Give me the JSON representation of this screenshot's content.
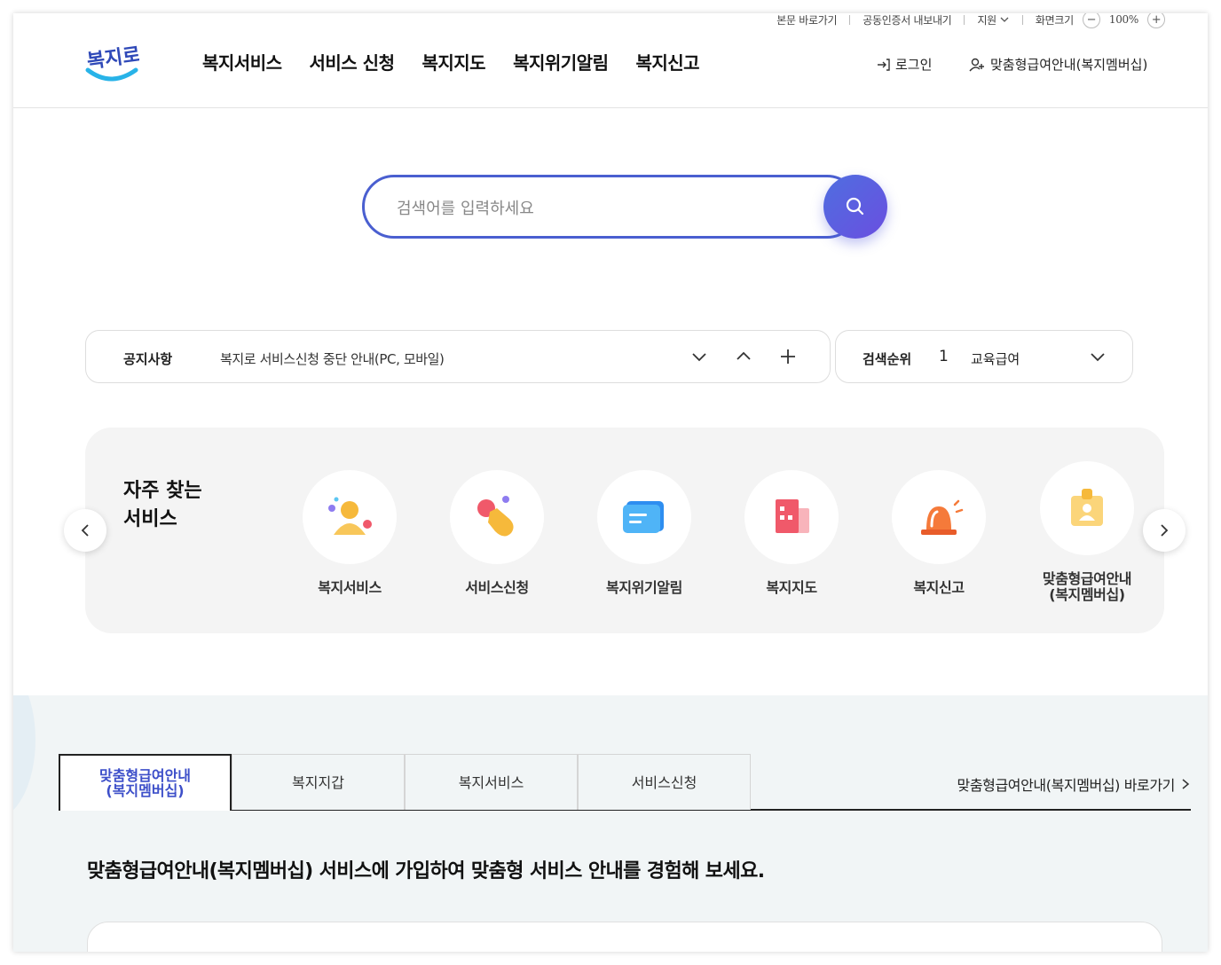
{
  "utility": {
    "skip": "본문 바로가기",
    "cert": "공동인증서 내보내기",
    "support": "지원",
    "screen_size": "화면크기",
    "zoom_minus": "−",
    "zoom": "100%",
    "zoom_plus": "+"
  },
  "header": {
    "logo_text": "복지로",
    "nav": [
      "복지서비스",
      "서비스 신청",
      "복지지도",
      "복지위기알림",
      "복지신고"
    ],
    "login": "로그인",
    "membership": "맞춤형급여안내(복지멤버십)"
  },
  "search": {
    "placeholder": "검색어를 입력하세요"
  },
  "notice": {
    "label": "공지사항",
    "text": "복지로 서비스신청 중단 안내(PC, 모바일)"
  },
  "rank": {
    "label": "검색순위",
    "number": "1",
    "text": "교육급여"
  },
  "frequent": {
    "title": "자주 찾는\n서비스",
    "items": [
      {
        "label": "복지서비스",
        "icon": "person-icon"
      },
      {
        "label": "서비스신청",
        "icon": "hand-pointer-icon"
      },
      {
        "label": "복지위기알림",
        "icon": "message-icon"
      },
      {
        "label": "복지지도",
        "icon": "building-icon"
      },
      {
        "label": "복지신고",
        "icon": "siren-icon"
      },
      {
        "label": "맞춤형급여안내\n(복지멤버십)",
        "icon": "id-badge-icon"
      }
    ]
  },
  "lower": {
    "tabs": [
      "맞춤형급여안내\n(복지멤버십)",
      "복지지갑",
      "복지서비스",
      "서비스신청"
    ],
    "goto": "맞춤형급여안내(복지멤버십) 바로가기",
    "headline": "맞춤형급여안내(복지멤버십) 서비스에 가입하여 맞춤형 서비스 안내를 경험해 보세요."
  },
  "colors": {
    "accent": "#3d4fc9",
    "search_border": "#4a5fd0"
  }
}
